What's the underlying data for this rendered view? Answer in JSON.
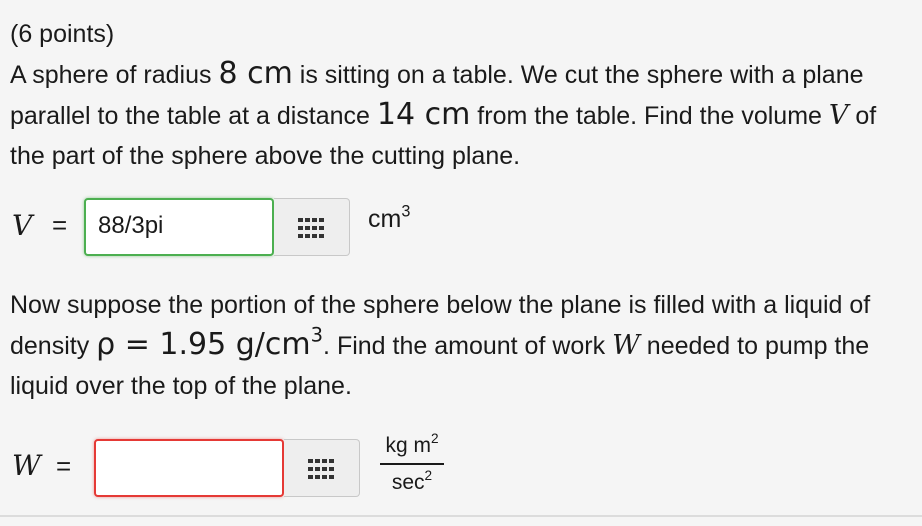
{
  "problem": {
    "points": "(6 points)",
    "p1_a": "A sphere of radius ",
    "p1_radius": "8 cm",
    "p1_b": " is sitting on a table. We cut the sphere with a plane parallel to the table at a distance ",
    "p1_distance": "14 cm",
    "p1_c": " from the table. Find the volume ",
    "p1_var": "V",
    "p1_d": " of the part of the sphere above the cutting plane.",
    "p2_a": "Now suppose the portion of the sphere below the plane is filled with a liquid of density ",
    "p2_density": "ρ = 1.95 g/cm",
    "p2_density_exp": "3",
    "p2_b": ". Find the amount of work ",
    "p2_var": "W",
    "p2_c": " needed to pump the liquid over the top of the plane."
  },
  "answer_v": {
    "label": "V",
    "equals": "=",
    "value": "88/3pi",
    "unit": "cm",
    "unit_exp": "3",
    "status": "correct",
    "status_color": "#4caf50",
    "palette_icon": "grid-palette-icon"
  },
  "answer_w": {
    "label": "W",
    "equals": "=",
    "value": "",
    "placeholder": "",
    "unit_num": "kg m",
    "unit_num_exp": "2",
    "unit_den": "sec",
    "unit_den_exp": "2",
    "status": "incorrect",
    "status_color": "#e53935",
    "palette_icon": "grid-palette-icon"
  }
}
